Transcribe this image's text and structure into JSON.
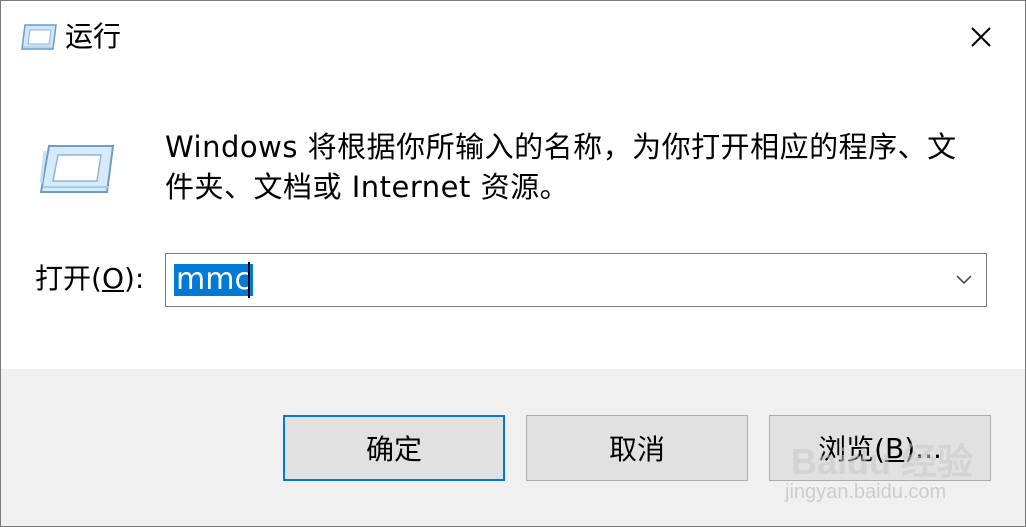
{
  "window": {
    "title": "运行"
  },
  "body": {
    "description_line1": "Windows 将根据你所输入的名称，为你打开相应的程序、文",
    "description_line2": "件夹、文档或 Internet 资源。",
    "open_label_prefix": "打开(",
    "open_label_mnemonic": "O",
    "open_label_suffix": "):",
    "combo_value": "mmc"
  },
  "buttons": {
    "ok": "确定",
    "cancel": "取消",
    "browse_prefix": "浏览(",
    "browse_mnemonic": "B",
    "browse_suffix": ")..."
  },
  "watermark": {
    "main": "Baidu 经验",
    "sub": "jingyan.baidu.com"
  },
  "colors": {
    "accent": "#0078d7",
    "footer_bg": "#f0f0f0",
    "button_bg": "#e1e1e1"
  },
  "icons": {
    "title": "run-app-icon",
    "dialog": "run-app-icon",
    "close": "close-icon",
    "dropdown": "chevron-down-icon"
  }
}
